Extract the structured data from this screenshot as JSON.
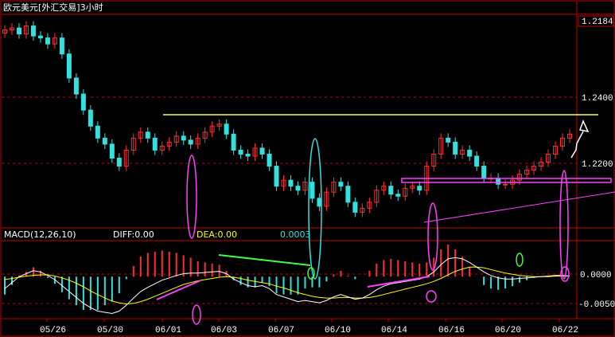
{
  "window": {
    "title": "欧元美元[外汇交易]3小时"
  },
  "colors": {
    "background": "#000000",
    "frame": "#c00000",
    "up_candle": "#ff3030",
    "down_candle": "#33e0e0",
    "support_line": "#ffff40",
    "trend_line": "#ff40ff",
    "diff_line": "#ffffff",
    "dea_line": "#ffff00",
    "divergence_green": "#40ff40",
    "axis_text": "#ffffff",
    "price_grid": "#c00000"
  },
  "price_axis": {
    "top_readout": "1.2184",
    "ticks": [
      "1.2400",
      "1.2200"
    ]
  },
  "macd_panel": {
    "name": "MACD(12,26,10)",
    "diff": "DIFF:0.00",
    "dea": "DEA:0.00",
    "macd": "0.0003",
    "ticks": [
      "0.0000",
      "-0.0050"
    ]
  },
  "date_axis": [
    "05/26",
    "05/30",
    "06/01",
    "06/03",
    "06/07",
    "06/10",
    "06/14",
    "06/16",
    "06/20",
    "06/22"
  ],
  "chart_data": {
    "type": "line",
    "title": "欧元美元[外汇交易]3小时",
    "price_ylim": [
      1.205,
      1.2575
    ],
    "macd_ylim": [
      -0.0068,
      0.0058
    ],
    "price_series": {
      "x": [
        0,
        1,
        2,
        3,
        4,
        5,
        6,
        7,
        8,
        9,
        10,
        11,
        12,
        13,
        14,
        15,
        16,
        17,
        18,
        19,
        20,
        21,
        22,
        23,
        24,
        25,
        26,
        27,
        28,
        29,
        30,
        31,
        32,
        33,
        34,
        35,
        36,
        37,
        38,
        39,
        40,
        41,
        42,
        43,
        44,
        45,
        46,
        47,
        48,
        49,
        50,
        51,
        52,
        53,
        54,
        55,
        56,
        57,
        58,
        59,
        60,
        61,
        62,
        63,
        64,
        65,
        66,
        67,
        68,
        69,
        70,
        71,
        72,
        73,
        74,
        75,
        76,
        77,
        78,
        79
      ],
      "values": [
        1.254,
        1.2545,
        1.253,
        1.255,
        1.2525,
        1.252,
        1.2505,
        1.252,
        1.248,
        1.242,
        1.238,
        1.234,
        1.23,
        1.227,
        1.2255,
        1.222,
        1.22,
        1.224,
        1.227,
        1.2285,
        1.227,
        1.224,
        1.225,
        1.226,
        1.2275,
        1.2265,
        1.2255,
        1.227,
        1.2285,
        1.23,
        1.2305,
        1.228,
        1.224,
        1.223,
        1.2225,
        1.2245,
        1.223,
        1.22,
        1.215,
        1.2165,
        1.215,
        1.214,
        1.216,
        1.212,
        1.21,
        1.2135,
        1.216,
        1.215,
        1.211,
        1.2085,
        1.2095,
        1.211,
        1.214,
        1.215,
        1.213,
        1.2125,
        1.2145,
        1.215,
        1.214,
        1.22,
        1.223,
        1.227,
        1.226,
        1.223,
        1.224,
        1.2225,
        1.22,
        1.217,
        1.217,
        1.2155,
        1.2155,
        1.2165,
        1.218,
        1.219,
        1.22,
        1.221,
        1.223,
        1.225,
        1.227,
        1.228
      ]
    },
    "macd_series": {
      "diff": [
        -0.002,
        -0.001,
        0.0,
        0.0005,
        0.001,
        0.0008,
        0.0002,
        -0.0005,
        -0.0015,
        -0.0025,
        -0.0035,
        -0.0045,
        -0.0052,
        -0.0058,
        -0.006,
        -0.0062,
        -0.0058,
        -0.0048,
        -0.0036,
        -0.0025,
        -0.0018,
        -0.0012,
        -0.0006,
        -0.0002,
        0.0002,
        0.0005,
        0.0006,
        0.0006,
        0.0007,
        0.0008,
        0.0009,
        0.0005,
        -0.0004,
        -0.001,
        -0.0015,
        -0.0017,
        -0.0015,
        -0.002,
        -0.003,
        -0.0034,
        -0.0038,
        -0.0042,
        -0.004,
        -0.0042,
        -0.0044,
        -0.004,
        -0.0034,
        -0.003,
        -0.0034,
        -0.0038,
        -0.0036,
        -0.003,
        -0.0022,
        -0.0016,
        -0.0012,
        -0.001,
        -0.0008,
        -0.0006,
        -0.0004,
        0.0,
        0.0008,
        0.002,
        0.003,
        0.0032,
        0.003,
        0.0024,
        0.0016,
        0.0008,
        0.0002,
        -0.0002,
        -0.0004,
        -0.0004,
        -0.0003,
        -0.0002,
        -0.0001,
        0.0,
        0.0001,
        0.0002,
        0.0002,
        0.0001
      ],
      "dea": [
        -0.0005,
        -0.0003,
        -0.0001,
        0.0001,
        0.0002,
        0.0003,
        0.0003,
        0.0001,
        -0.0002,
        -0.0006,
        -0.0011,
        -0.0017,
        -0.0024,
        -0.003,
        -0.0036,
        -0.0041,
        -0.0044,
        -0.0046,
        -0.0045,
        -0.0042,
        -0.0038,
        -0.0033,
        -0.0028,
        -0.0023,
        -0.0018,
        -0.0013,
        -0.001,
        -0.0007,
        -0.0005,
        -0.0003,
        -0.0001,
        0.0,
        -0.0001,
        -0.0003,
        -0.0006,
        -0.0008,
        -0.001,
        -0.0012,
        -0.0016,
        -0.0019,
        -0.0023,
        -0.0027,
        -0.003,
        -0.0033,
        -0.0035,
        -0.0036,
        -0.0036,
        -0.0035,
        -0.0035,
        -0.0036,
        -0.0036,
        -0.0035,
        -0.0033,
        -0.003,
        -0.0027,
        -0.0024,
        -0.0021,
        -0.0018,
        -0.0015,
        -0.0012,
        -0.0008,
        -0.0003,
        0.0003,
        0.0009,
        0.0013,
        0.0016,
        0.0016,
        0.0015,
        0.0012,
        0.0009,
        0.0006,
        0.0004,
        0.0002,
        0.0001,
        0.0,
        0.0,
        0.0,
        0.0001,
        0.0001,
        0.0001
      ]
    }
  }
}
